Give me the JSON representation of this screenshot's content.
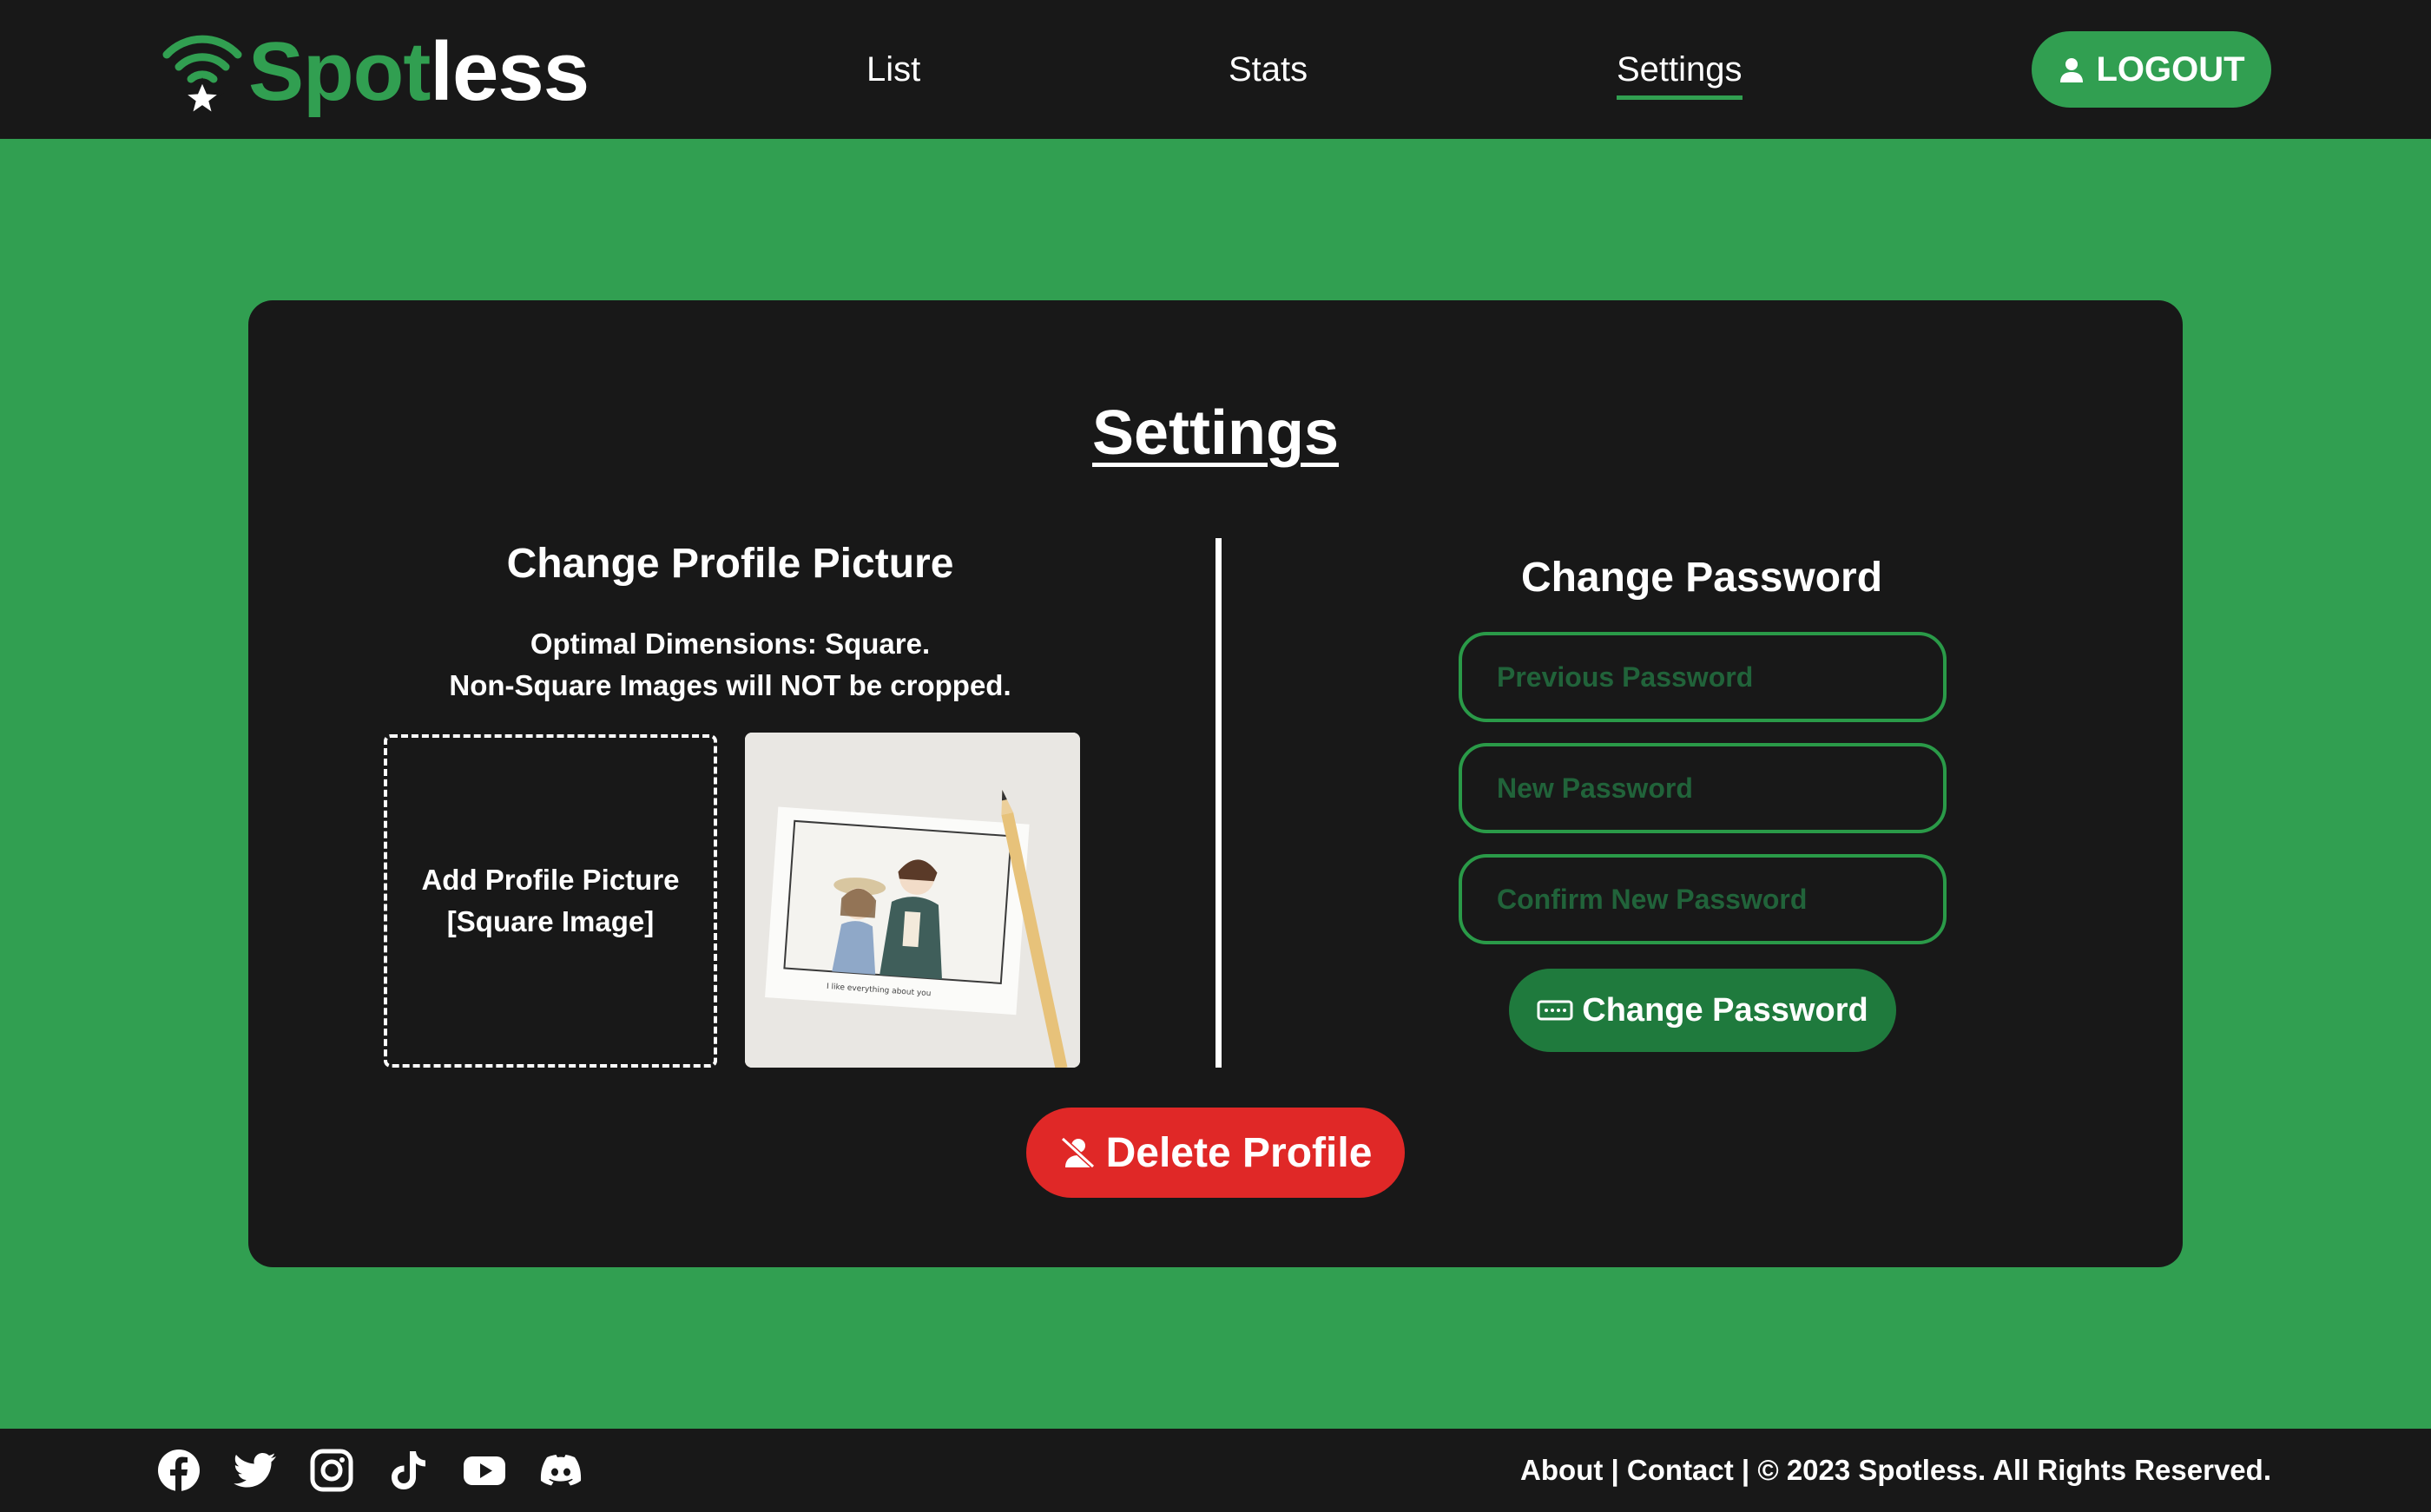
{
  "brand": {
    "name_part1": "Spot",
    "name_part2": "less",
    "accent_color": "#319f51"
  },
  "nav": {
    "items": [
      {
        "label": "List",
        "active": false
      },
      {
        "label": "Stats",
        "active": false
      },
      {
        "label": "Settings",
        "active": true
      }
    ],
    "logout_label": "LOGOUT",
    "logout_icon": "user-icon"
  },
  "settings": {
    "title": "Settings",
    "profile_picture": {
      "heading": "Change Profile Picture",
      "dims_prefix": "Optimal Dimensions: ",
      "dims_value": "Square",
      "dims_suffix": ".",
      "crop_note": "Non-Square Images will NOT be cropped.",
      "upload_line1": "Add Profile Picture",
      "upload_line2": "[Square Image]",
      "preview_caption": "I like everything about you"
    },
    "password": {
      "heading": "Change Password",
      "previous_placeholder": "Previous Password",
      "new_placeholder": "New Password",
      "confirm_placeholder": "Confirm New Password",
      "submit_label": "Change Password",
      "submit_icon": "password-icon"
    },
    "delete_label": "Delete Profile",
    "delete_icon": "user-slash-icon",
    "delete_color": "#e02827"
  },
  "footer": {
    "social_icons": [
      "facebook-icon",
      "twitter-icon",
      "instagram-icon",
      "tiktok-icon",
      "youtube-icon",
      "discord-icon"
    ],
    "about_label": "About",
    "contact_label": "Contact",
    "sep": " | ",
    "copyright": "© 2023 Spotless. All Rights Reserved."
  }
}
